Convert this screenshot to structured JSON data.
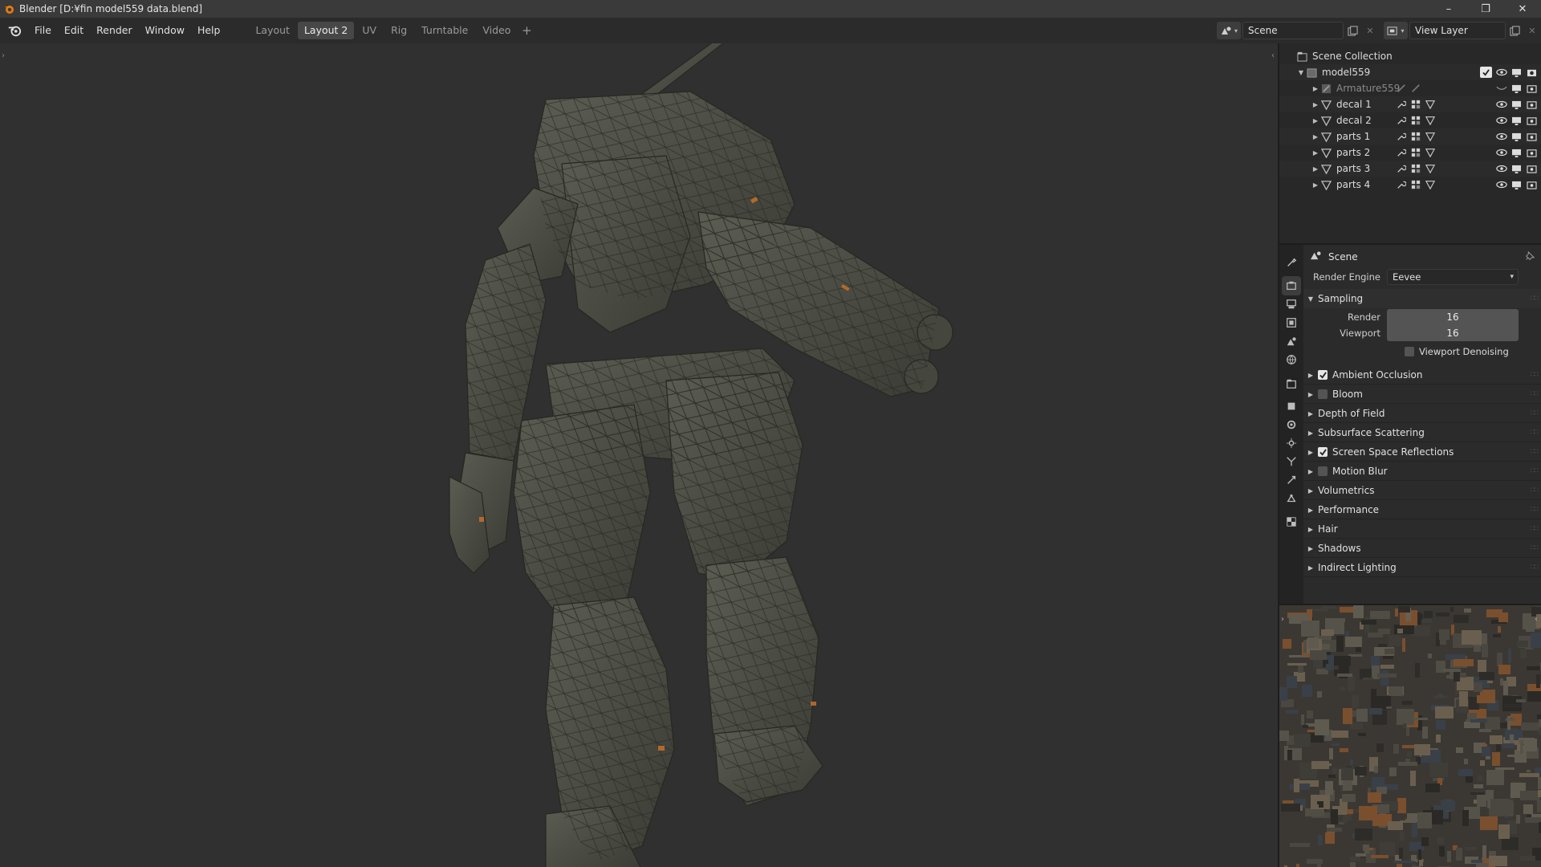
{
  "window": {
    "title": "Blender [D:¥fin model559 data.blend]",
    "controls": [
      "–",
      "❐",
      "✕"
    ]
  },
  "menu": [
    "File",
    "Edit",
    "Render",
    "Window",
    "Help"
  ],
  "workspaces": {
    "tabs": [
      "Layout",
      "Layout 2",
      "UV",
      "Rig",
      "Turntable",
      "Video"
    ],
    "active": "Layout 2",
    "add": "+"
  },
  "header_right": {
    "scene_name": "Scene",
    "view_layer_name": "View Layer"
  },
  "outliner": {
    "root": "Scene Collection",
    "collection": "model559",
    "items": [
      {
        "name": "Armature559",
        "type": "armature",
        "dimmed": true
      },
      {
        "name": "decal 1",
        "type": "mesh"
      },
      {
        "name": "decal 2",
        "type": "mesh"
      },
      {
        "name": "parts 1",
        "type": "mesh"
      },
      {
        "name": "parts 2",
        "type": "mesh"
      },
      {
        "name": "parts 3",
        "type": "mesh"
      },
      {
        "name": "parts 4",
        "type": "mesh"
      }
    ]
  },
  "properties": {
    "context": "Scene",
    "render_engine_label": "Render Engine",
    "render_engine_value": "Eevee",
    "sampling": {
      "title": "Sampling",
      "render_label": "Render",
      "render_value": "16",
      "viewport_label": "Viewport",
      "viewport_value": "16",
      "denoise_label": "Viewport Denoising",
      "denoise_checked": false
    },
    "panels": [
      {
        "label": "Ambient Occlusion",
        "checkbox": true,
        "checked": true
      },
      {
        "label": "Bloom",
        "checkbox": true,
        "checked": false
      },
      {
        "label": "Depth of Field",
        "checkbox": false
      },
      {
        "label": "Subsurface Scattering",
        "checkbox": false
      },
      {
        "label": "Screen Space Reflections",
        "checkbox": true,
        "checked": true
      },
      {
        "label": "Motion Blur",
        "checkbox": true,
        "checked": false
      },
      {
        "label": "Volumetrics",
        "checkbox": false
      },
      {
        "label": "Performance",
        "checkbox": false
      },
      {
        "label": "Hair",
        "checkbox": false
      },
      {
        "label": "Shadows",
        "checkbox": false
      },
      {
        "label": "Indirect Lighting",
        "checkbox": false
      }
    ],
    "tabs": [
      "tool-icon",
      "render-icon",
      "output-icon",
      "view-layer-icon",
      "scene-icon",
      "world-icon",
      "collection-icon",
      "object-icon",
      "modifier-icon",
      "particles-icon",
      "physics-icon",
      "constraints-icon",
      "data-icon",
      "texture-icon"
    ]
  },
  "colors": {
    "accent": "#e87d0d",
    "panel_bg": "#2b2b2b",
    "viewport_bg": "#303030",
    "active_tab": "#474747"
  }
}
